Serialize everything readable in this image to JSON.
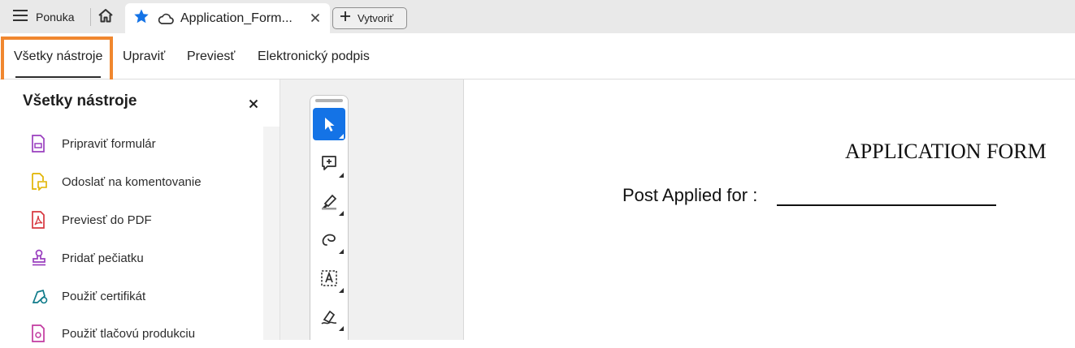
{
  "titlebar": {
    "menu_label": "Ponuka",
    "document_tab_title": "Application_Form...",
    "new_button_label": "Vytvoriť"
  },
  "tool_tabs": [
    {
      "label": "Všetky nástroje",
      "active": true
    },
    {
      "label": "Upraviť",
      "active": false
    },
    {
      "label": "Previesť",
      "active": false
    },
    {
      "label": "Elektronický podpis",
      "active": false
    }
  ],
  "left_panel": {
    "title": "Všetky nástroje",
    "items": [
      {
        "label": "Pripraviť formulár",
        "icon": "form-icon",
        "color": "#9a3fbf"
      },
      {
        "label": "Odoslať na komentovanie",
        "icon": "comment-doc-icon",
        "color": "#e1b400"
      },
      {
        "label": "Previesť do PDF",
        "icon": "pdf-icon",
        "color": "#d7373f"
      },
      {
        "label": "Pridať pečiatku",
        "icon": "stamp-icon",
        "color": "#9a3fbf"
      },
      {
        "label": "Použiť certifikát",
        "icon": "certificate-icon",
        "color": "#0f7b8a"
      },
      {
        "label": "Použiť tlačovú produkciu",
        "icon": "print-production-icon",
        "color": "#c23aa0"
      }
    ]
  },
  "vertical_toolbar": [
    {
      "name": "select-tool",
      "icon": "cursor-icon",
      "selected": true
    },
    {
      "name": "add-comment-tool",
      "icon": "comment-plus-icon",
      "selected": false
    },
    {
      "name": "highlight-tool",
      "icon": "highlighter-icon",
      "selected": false
    },
    {
      "name": "draw-tool",
      "icon": "freehand-icon",
      "selected": false
    },
    {
      "name": "text-box-tool",
      "icon": "text-box-icon",
      "selected": false
    },
    {
      "name": "sign-tool",
      "icon": "sign-pen-icon",
      "selected": false
    }
  ],
  "document": {
    "heading": "APPLICATION FORM",
    "post_applied_label": "Post Applied for  :"
  },
  "colors": {
    "accent": "#1473e6",
    "highlight_box": "#f0872f",
    "tab_bar": "#e9e9e9",
    "star": "#1473e6"
  }
}
